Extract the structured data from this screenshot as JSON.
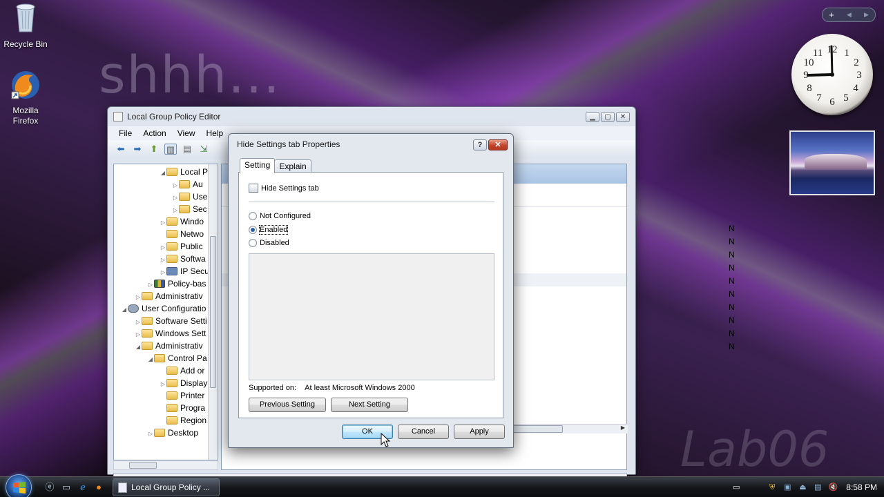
{
  "desktop": {
    "icons": [
      {
        "label": "Recycle Bin"
      },
      {
        "label": "Mozilla Firefox"
      }
    ],
    "wallpaper_text": "shhh...",
    "watermark": "Lab06"
  },
  "clock": {
    "numbers": [
      "12",
      "1",
      "2",
      "3",
      "4",
      "5",
      "6",
      "7",
      "8",
      "9",
      "10",
      "11"
    ],
    "time_shown": "8:58"
  },
  "gadget_bar": {
    "add": "+",
    "prev": "◀",
    "next": "▶"
  },
  "gpe_window": {
    "title": "Local Group Policy Editor",
    "menu": [
      "File",
      "Action",
      "View",
      "Help"
    ],
    "tree": [
      {
        "label": "Local P",
        "expanded": true
      },
      {
        "label": "Au"
      },
      {
        "label": "Use"
      },
      {
        "label": "Sec"
      },
      {
        "label": "Windo"
      },
      {
        "label": "Netwo"
      },
      {
        "label": "Public"
      },
      {
        "label": "Softwa"
      },
      {
        "label": "IP Secu"
      },
      {
        "label": "Policy-bas"
      },
      {
        "label": "Administrativ"
      },
      {
        "label": "User Configuratio"
      },
      {
        "label": "Software Setti"
      },
      {
        "label": "Windows Sett"
      },
      {
        "label": "Administrativ"
      },
      {
        "label": "Control Pa"
      },
      {
        "label": "Add or"
      },
      {
        "label": "Display"
      },
      {
        "label": "Printer"
      },
      {
        "label": "Progra"
      },
      {
        "label": "Region"
      },
      {
        "label": "Desktop"
      }
    ],
    "right_state_col": [
      "N",
      "N",
      "N",
      "N",
      "N",
      "N",
      "N",
      "N",
      "N",
      "N"
    ]
  },
  "dialog": {
    "title": "Hide Settings tab Properties",
    "help": "?",
    "close": "✕",
    "tabs": [
      "Setting",
      "Explain"
    ],
    "setting_name": "Hide Settings tab",
    "options": [
      {
        "label": "Not Configured",
        "selected": false
      },
      {
        "label": "Enabled",
        "selected": true
      },
      {
        "label": "Disabled",
        "selected": false
      }
    ],
    "supported_label": "Supported on:",
    "supported_value": "At least Microsoft Windows 2000",
    "previous": "Previous Setting",
    "next": "Next Setting",
    "ok": "OK",
    "cancel": "Cancel",
    "apply": "Apply"
  },
  "taskbar": {
    "active_task": "Local Group Policy ...",
    "time": "8:58 PM"
  }
}
